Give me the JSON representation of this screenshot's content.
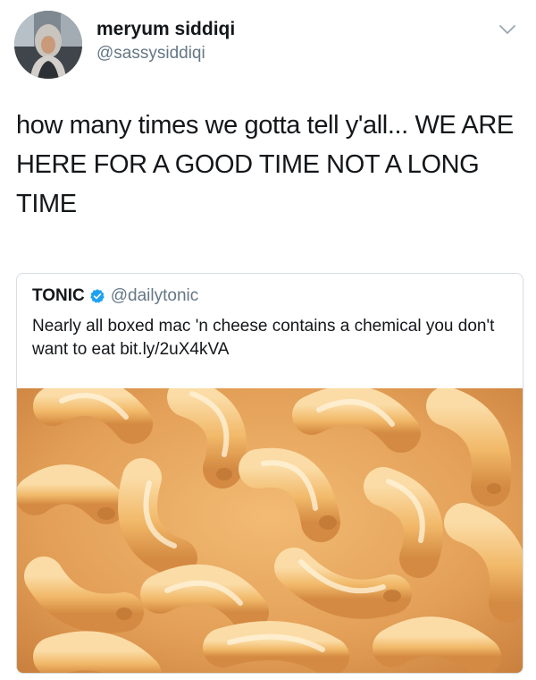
{
  "author": {
    "display_name": "meryum siddiqi",
    "handle": "@sassysiddiqi",
    "avatar_icon": "profile-photo",
    "menu_icon": "chevron-down-icon"
  },
  "tweet": {
    "text": "how many times we gotta tell y'all... WE ARE HERE FOR A GOOD TIME NOT A LONG TIME"
  },
  "quoted_tweet": {
    "display_name": "TONIC",
    "verified_icon": "verified-badge-icon",
    "handle": "@dailytonic",
    "text": "Nearly all boxed mac 'n cheese contains a chemical you don't want to eat bit.ly/2uX4kVA",
    "media": "mac-and-cheese-photo"
  },
  "colors": {
    "text": "#14171a",
    "secondary": "#657786",
    "verified": "#1da1f2",
    "border": "#d6dde3",
    "cheese": "#e9a860"
  }
}
